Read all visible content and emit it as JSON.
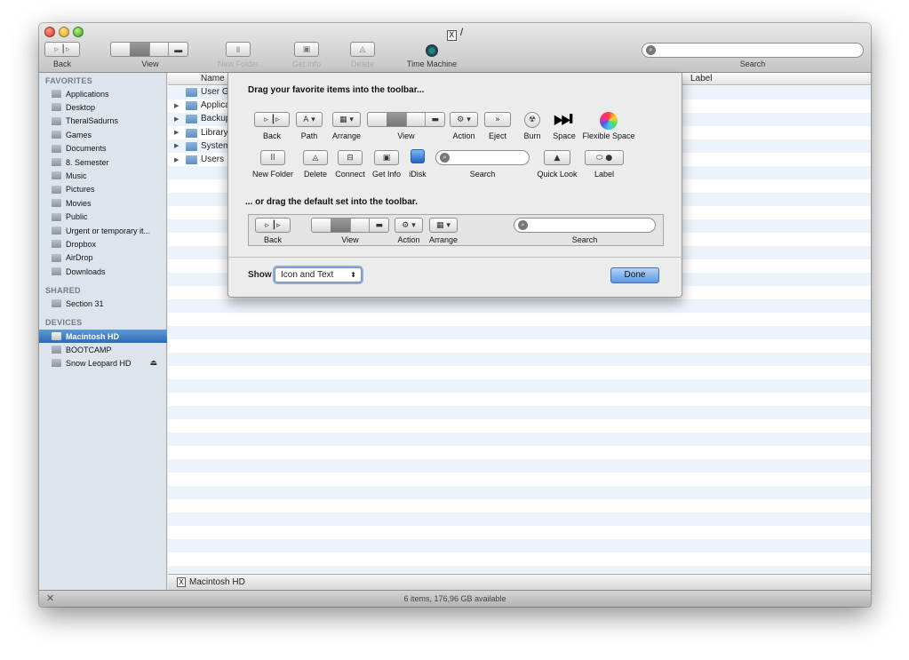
{
  "window": {
    "title": "/"
  },
  "toolbar": {
    "back_label": "Back",
    "view_label": "View",
    "new_folder_label": "New Folder",
    "get_info_label": "Get Info",
    "delete_label": "Delete",
    "time_machine_label": "Time Machine",
    "search_label": "Search"
  },
  "sidebar": {
    "favorites_header": "FAVORITES",
    "favorites": [
      "Applications",
      "Desktop",
      "TheralSadurns",
      "Games",
      "Documents",
      "8. Semester",
      "Music",
      "Pictures",
      "Movies",
      "Public",
      "Urgent or temporary it...",
      "Dropbox",
      "AirDrop",
      "Downloads"
    ],
    "shared_header": "SHARED",
    "shared": [
      "Section 31"
    ],
    "devices_header": "DEVICES",
    "devices": [
      "Macintosh HD",
      "BOOTCAMP",
      "Snow Leopard HD"
    ],
    "selected_device": "Macintosh HD",
    "eject_symbol": "⏏"
  },
  "list": {
    "columns": {
      "name": "Name",
      "label": "Label"
    },
    "rows": [
      "User G",
      "Applica",
      "Backup",
      "Library",
      "System",
      "Users"
    ]
  },
  "pathbar": {
    "item": "Macintosh HD"
  },
  "status": {
    "text": "6 items, 176,96 GB available"
  },
  "customize": {
    "heading_favorites": "Drag your favorite items into the toolbar...",
    "heading_default": "... or drag the default set into the toolbar.",
    "items": {
      "back": "Back",
      "path": "Path",
      "arrange": "Arrange",
      "view": "View",
      "action": "Action",
      "eject": "Eject",
      "burn": "Burn",
      "space": "Space",
      "flexible_space": "Flexible Space",
      "new_folder": "New Folder",
      "delete": "Delete",
      "connect": "Connect",
      "get_info": "Get Info",
      "idisk": "iDisk",
      "search": "Search",
      "quick_look": "Quick Look",
      "label": "Label"
    },
    "default_set": {
      "back": "Back",
      "view": "View",
      "action": "Action",
      "arrange": "Arrange",
      "search": "Search"
    },
    "show_label": "Show",
    "show_value": "Icon and Text",
    "done_label": "Done"
  }
}
